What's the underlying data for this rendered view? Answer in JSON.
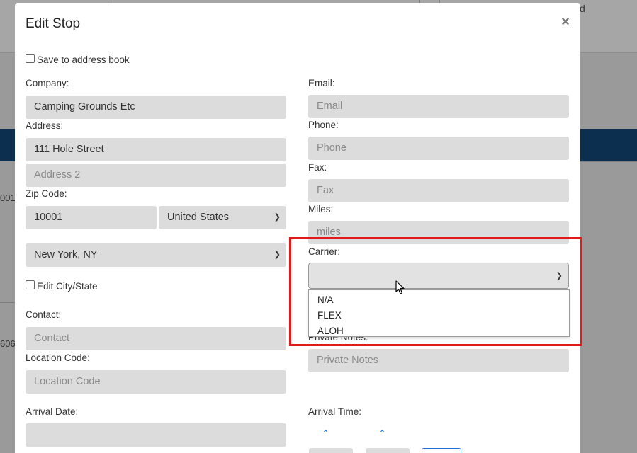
{
  "background": {
    "top_right_text": "d",
    "left_text_1": "001 (",
    "left_text_2": "606"
  },
  "modal": {
    "title": "Edit Stop",
    "close_symbol": "×",
    "save_to_address_book_label": "Save to address book",
    "company": {
      "label": "Company:",
      "value": "Camping Grounds Etc"
    },
    "address": {
      "label": "Address:",
      "value": "111 Hole Street",
      "address2_placeholder": "Address 2"
    },
    "zip": {
      "label": "Zip Code:",
      "value": "10001",
      "country": "United States"
    },
    "city_state": {
      "value": "New York, NY"
    },
    "edit_city_state_label": "Edit City/State",
    "contact": {
      "label": "Contact:",
      "placeholder": "Contact"
    },
    "location_code": {
      "label": "Location Code:",
      "placeholder": "Location Code"
    },
    "arrival_date": {
      "label": "Arrival Date:",
      "value": ""
    },
    "email": {
      "label": "Email:",
      "placeholder": "Email"
    },
    "phone": {
      "label": "Phone:",
      "placeholder": "Phone"
    },
    "fax": {
      "label": "Fax:",
      "placeholder": "Fax"
    },
    "miles": {
      "label": "Miles:",
      "placeholder": "miles"
    },
    "carrier": {
      "label": "Carrier:",
      "selected": "",
      "options": [
        "N/A",
        "FLEX",
        "ALOH"
      ]
    },
    "private_notes": {
      "label": "Private Notes:",
      "placeholder": "Private Notes"
    },
    "arrival_time": {
      "label": "Arrival Time:"
    }
  },
  "colors": {
    "accent_blue": "#1f6fd0",
    "highlight_red": "#e01b1b",
    "navbar": "#0c2e4f",
    "field_bg": "#dcdcdc"
  }
}
